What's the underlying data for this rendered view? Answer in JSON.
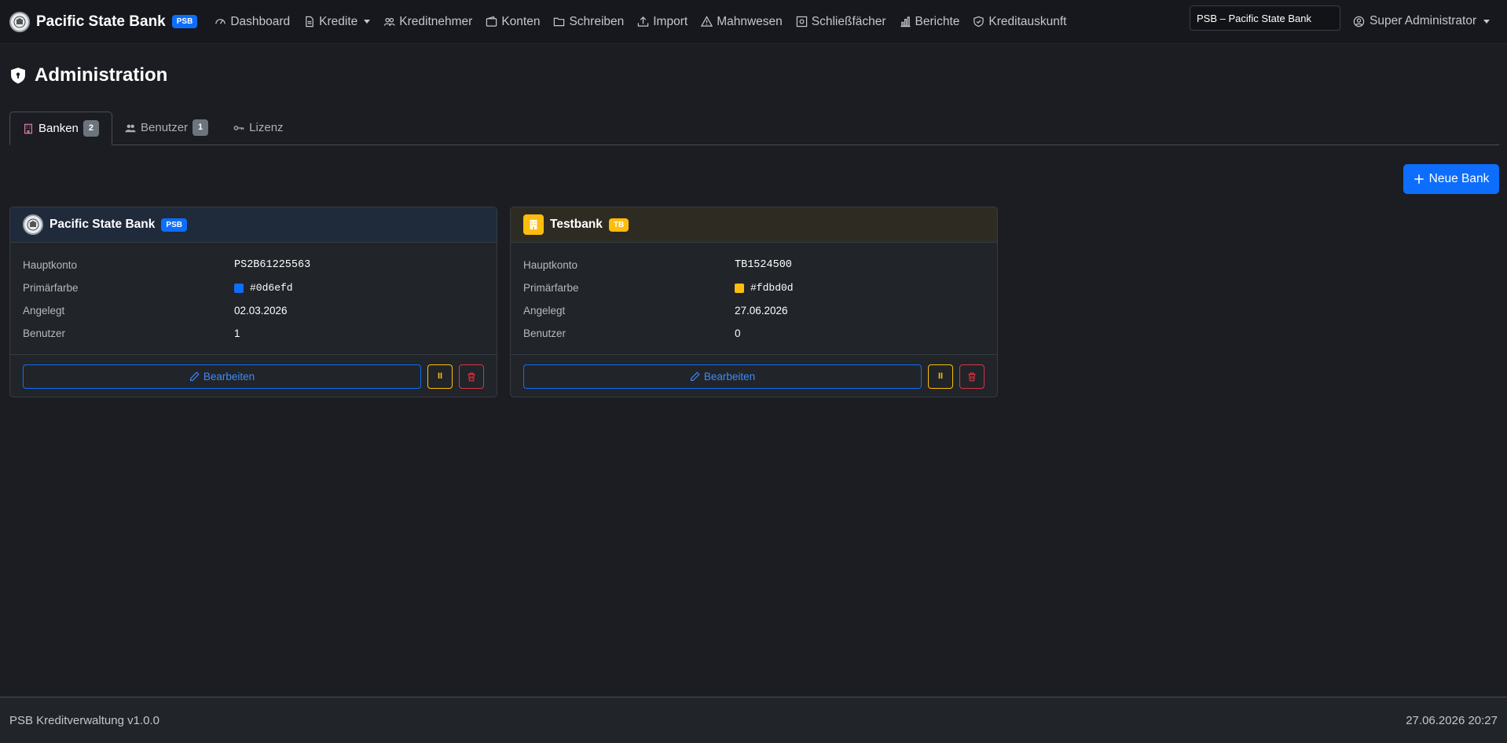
{
  "navbar": {
    "brand_title": "Pacific State Bank",
    "brand_badge": "PSB",
    "items": [
      {
        "label": "Dashboard",
        "icon": "speedometer-icon"
      },
      {
        "label": "Kredite",
        "icon": "document-icon",
        "dropdown": true
      },
      {
        "label": "Kreditnehmer",
        "icon": "people-icon"
      },
      {
        "label": "Konten",
        "icon": "wallet-icon"
      },
      {
        "label": "Schreiben",
        "icon": "folder-icon"
      },
      {
        "label": "Import",
        "icon": "upload-icon"
      },
      {
        "label": "Mahnwesen",
        "icon": "warning-triangle-icon"
      },
      {
        "label": "Schließfächer",
        "icon": "safe-icon"
      },
      {
        "label": "Berichte",
        "icon": "bar-chart-icon"
      },
      {
        "label": "Kreditauskunft",
        "icon": "shield-check-icon"
      }
    ],
    "bank_select_value": "PSB – Pacific State Bank",
    "user_label": "Super Administrator"
  },
  "page": {
    "title": "Administration"
  },
  "tabs": [
    {
      "label": "Banken",
      "count": "2",
      "active": true
    },
    {
      "label": "Benutzer",
      "count": "1",
      "active": false
    },
    {
      "label": "Lizenz",
      "count": "",
      "active": false
    }
  ],
  "new_bank_label": "Neue Bank",
  "labels": {
    "hauptkonto": "Hauptkonto",
    "primaerfarbe": "Primärfarbe",
    "angelegt": "Angelegt",
    "benutzer": "Benutzer",
    "edit": "Bearbeiten",
    "pause": "II"
  },
  "banks": [
    {
      "name": "Pacific State Bank",
      "badge": "PSB",
      "hauptkonto": "PS2B61225563",
      "color": "#0d6efd",
      "color_label": "#0d6efd",
      "angelegt": "02.03.2026",
      "benutzer": "1"
    },
    {
      "name": "Testbank",
      "badge": "TB",
      "hauptkonto": "TB1524500",
      "color": "#fdbd0d",
      "color_label": "#fdbd0d",
      "angelegt": "27.06.2026",
      "benutzer": "0"
    }
  ],
  "footer": {
    "left": "PSB Kreditverwaltung v1.0.0",
    "right": "27.06.2026 20:27"
  }
}
